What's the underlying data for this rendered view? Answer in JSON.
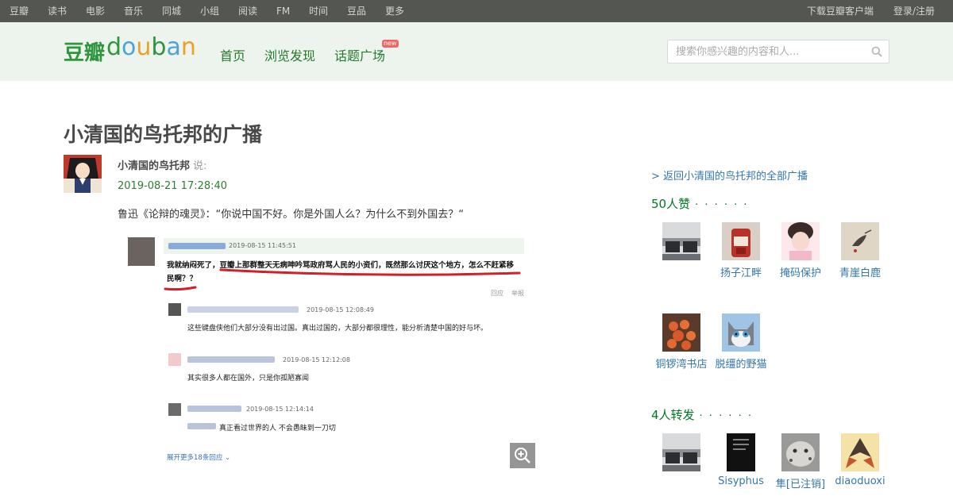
{
  "global_nav": {
    "left": [
      "豆瓣",
      "读书",
      "电影",
      "音乐",
      "同城",
      "小组",
      "阅读",
      "FM",
      "时间",
      "豆品",
      "更多"
    ],
    "download": "下载豆瓣客户端",
    "login": "登录/注册"
  },
  "header": {
    "logo_cn": "豆瓣",
    "logo_en": [
      "d",
      "o",
      "u",
      "b",
      "a",
      "n"
    ],
    "logo_colors": [
      "#2e963d",
      "#4da3d8",
      "#e9a12b",
      "#2e963d",
      "#4da3d8",
      "#e9a12b"
    ],
    "nav": [
      "首页",
      "浏览发现",
      "话题广场"
    ],
    "new_badge": "new",
    "search_placeholder": "搜索你感兴趣的内容和人..."
  },
  "page": {
    "title": "小清国的鸟托邦的广播",
    "author": "小清国的鸟托邦",
    "said": "说:",
    "time": "2019-08-21 17:28:40",
    "text": "鲁迅《论辩的魂灵》：“你说中国不好。你是外国人么？为什么不到外国去？“"
  },
  "embedded": {
    "main_time": "2019-08-15 11:45:51",
    "main_line1": "我就纳闷死了，豆瓣上那群整天无病呻吟骂政府骂人民的小资们，既然那么讨厌这个地方，怎么不赶紧移",
    "main_line2": "民啊？？",
    "reply": "回应",
    "report": "举报",
    "replies": [
      {
        "time": "2019-08-15 12:08:49",
        "text": "这些键盘侠他们大部分没有出过国。真出过国的，大部分都很理性，能分析清楚中国的好与坏。"
      },
      {
        "time": "2019-08-15 12:12:08",
        "text": "其实很多人都在国外，只是你孤陋寡闻"
      },
      {
        "time": "2019-08-15 12:14:14",
        "text": "真正看过世界的人 不会愚昧到一刀切"
      }
    ],
    "more": "展开更多18条回应"
  },
  "sidebar": {
    "back": "> 返回小清国的鸟托邦的全部广播",
    "likes_title": "50人赞",
    "dots": "· · · · · ·",
    "likers": [
      "",
      "扬子江畔",
      "掩码保护",
      "青崖白鹿",
      "铜锣湾书店",
      "脱缰的野猫"
    ],
    "reshares_title": "4人转发",
    "resharers": [
      "",
      "Sisyphus",
      "隼[已注销]",
      "diaoduoxi"
    ]
  }
}
